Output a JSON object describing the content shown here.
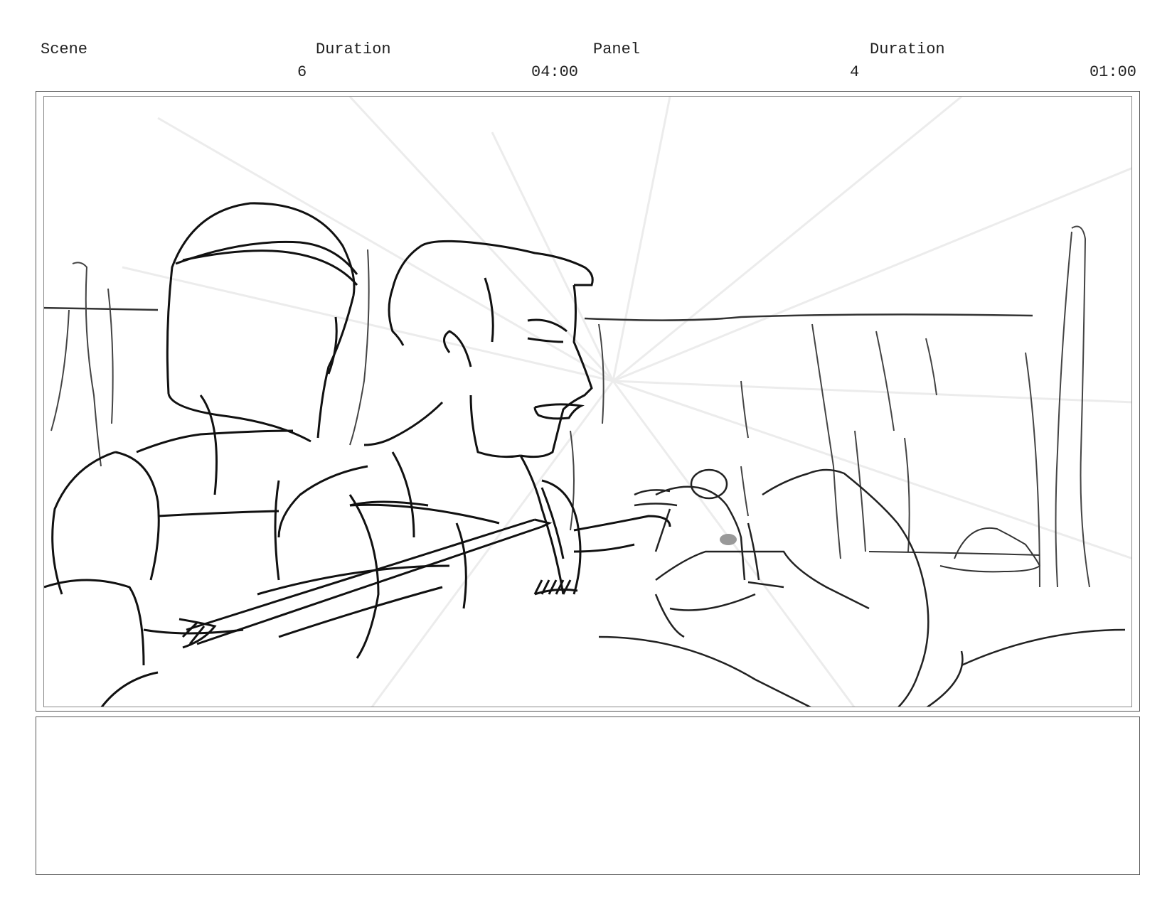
{
  "header": {
    "scene_label": "Scene",
    "duration_label_1": "Duration",
    "panel_label": "Panel",
    "duration_label_2": "Duration",
    "scene_value": "6",
    "scene_duration": "04:00",
    "panel_value": "4",
    "panel_duration": "01:00"
  },
  "notes": {
    "text": ""
  }
}
